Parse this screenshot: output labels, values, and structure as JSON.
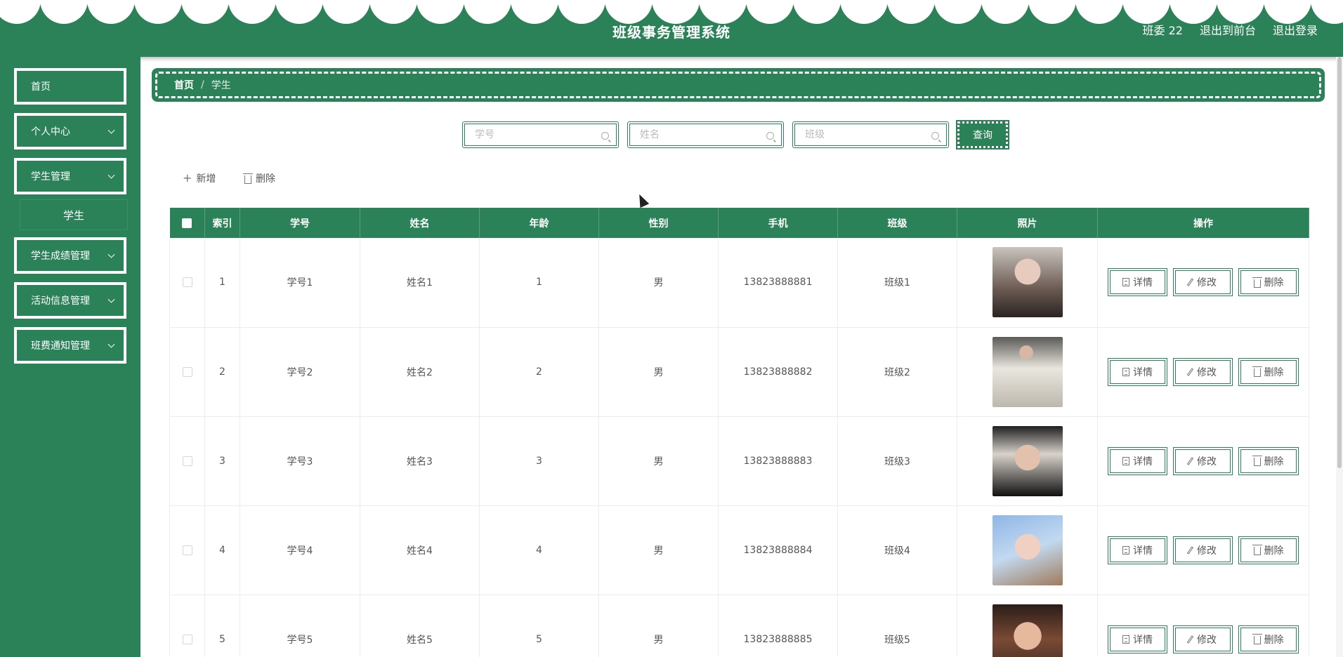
{
  "header": {
    "title": "班级事务管理系统",
    "user": "班委 22",
    "to_front": "退出到前台",
    "logout": "退出登录"
  },
  "sidebar": {
    "items": [
      {
        "label": "首页",
        "has_submenu": false
      },
      {
        "label": "个人中心",
        "has_submenu": true
      },
      {
        "label": "学生管理",
        "has_submenu": true
      },
      {
        "label": "学生成绩管理",
        "has_submenu": true
      },
      {
        "label": "活动信息管理",
        "has_submenu": true
      },
      {
        "label": "班费通知管理",
        "has_submenu": true
      }
    ],
    "submenu_active": "学生"
  },
  "breadcrumb": {
    "home": "首页",
    "separator": "/",
    "current": "学生"
  },
  "search": {
    "student_no_placeholder": "学号",
    "name_placeholder": "姓名",
    "class_placeholder": "班级",
    "query_label": "查询"
  },
  "actions": {
    "add_label": "新增",
    "delete_label": "删除"
  },
  "table": {
    "headers": [
      "索引",
      "学号",
      "姓名",
      "年龄",
      "性别",
      "手机",
      "班级",
      "照片",
      "操作"
    ],
    "rows": [
      {
        "index": "1",
        "student_no": "学号1",
        "name": "姓名1",
        "age": "1",
        "gender": "男",
        "phone": "13823888881",
        "class": "班级1"
      },
      {
        "index": "2",
        "student_no": "学号2",
        "name": "姓名2",
        "age": "2",
        "gender": "男",
        "phone": "13823888882",
        "class": "班级2"
      },
      {
        "index": "3",
        "student_no": "学号3",
        "name": "姓名3",
        "age": "3",
        "gender": "男",
        "phone": "13823888883",
        "class": "班级3"
      },
      {
        "index": "4",
        "student_no": "学号4",
        "name": "姓名4",
        "age": "4",
        "gender": "男",
        "phone": "13823888884",
        "class": "班级4"
      },
      {
        "index": "5",
        "student_no": "学号5",
        "name": "姓名5",
        "age": "5",
        "gender": "男",
        "phone": "13823888885",
        "class": "班级5"
      }
    ],
    "op_labels": {
      "detail": "详情",
      "edit": "修改",
      "delete": "删除"
    }
  },
  "colors": {
    "primary": "#2b8158",
    "white": "#ffffff"
  }
}
